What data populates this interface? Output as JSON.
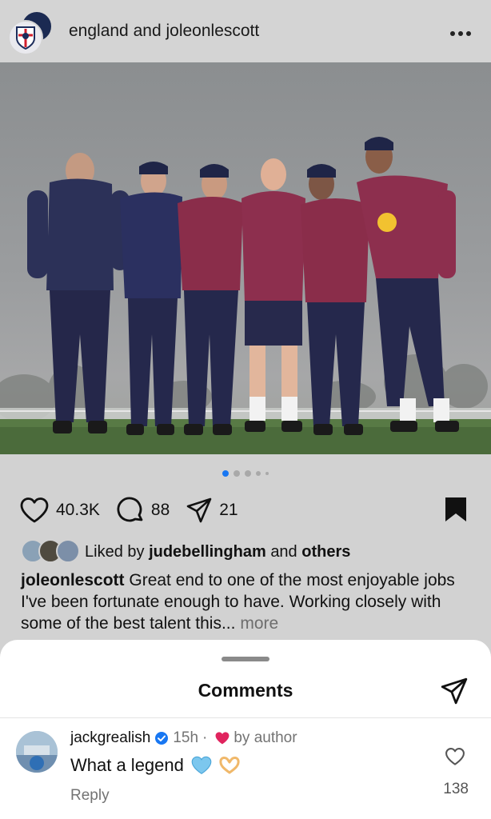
{
  "header": {
    "account_1": "england",
    "joiner": "and",
    "account_2": "joleonlescott",
    "more_icon": "more-horizontal-icon"
  },
  "carousel": {
    "total": 5,
    "active_index": 0
  },
  "actions": {
    "likes": "40.3K",
    "comments": "88",
    "shares": "21",
    "saved": true
  },
  "liked_by": {
    "prefix": "Liked by",
    "user": "judebellingham",
    "joiner": "and",
    "suffix": "others"
  },
  "caption": {
    "user": "joleonlescott",
    "text": "Great end to one of the most enjoyable jobs I've been fortunate enough to have. Working closely with some of the best talent this...",
    "more": "more"
  },
  "comments_sheet": {
    "title": "Comments",
    "items": [
      {
        "user": "jackgrealish",
        "verified": true,
        "time": "15h",
        "separator": "·",
        "by_author": "by author",
        "text": "What a legend",
        "likes": "138",
        "reply_label": "Reply"
      }
    ]
  },
  "colors": {
    "accent": "#1877f2",
    "heart_red": "#e0245e",
    "sheet_bg": "#ffffff",
    "page_bg": "#d2d2d2"
  }
}
